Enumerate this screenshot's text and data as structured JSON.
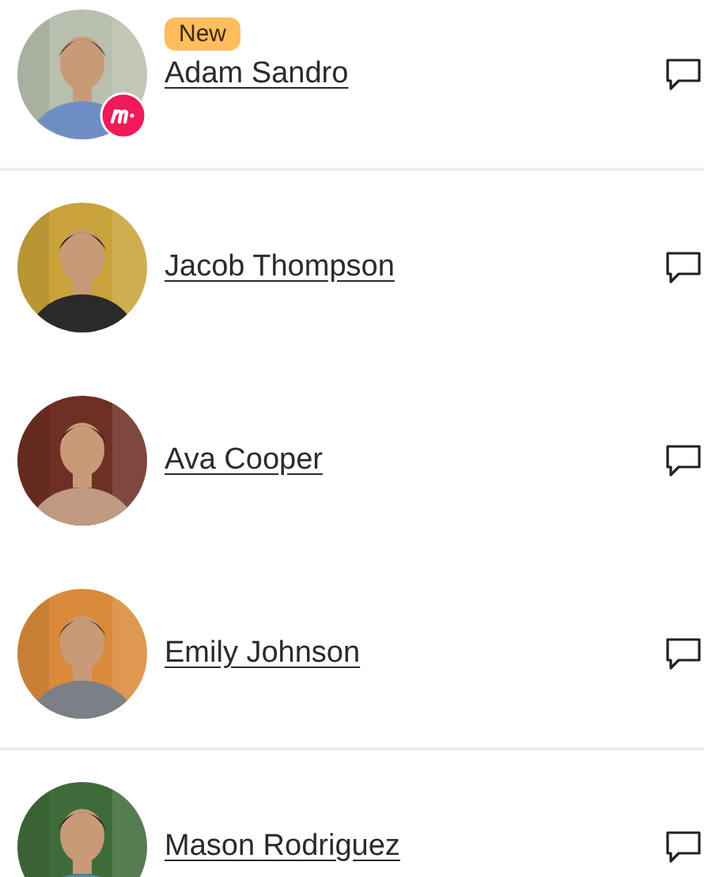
{
  "members": [
    {
      "name": "Adam Sandro",
      "badge": "New",
      "organizer": true,
      "divider_after": true
    },
    {
      "name": "Jacob Thompson",
      "organizer": false,
      "divider_after": false
    },
    {
      "name": "Ava Cooper",
      "organizer": false,
      "divider_after": false
    },
    {
      "name": "Emily Johnson",
      "organizer": false,
      "divider_after": true
    },
    {
      "name": "Mason Rodriguez",
      "organizer": false,
      "divider_after": false
    }
  ]
}
